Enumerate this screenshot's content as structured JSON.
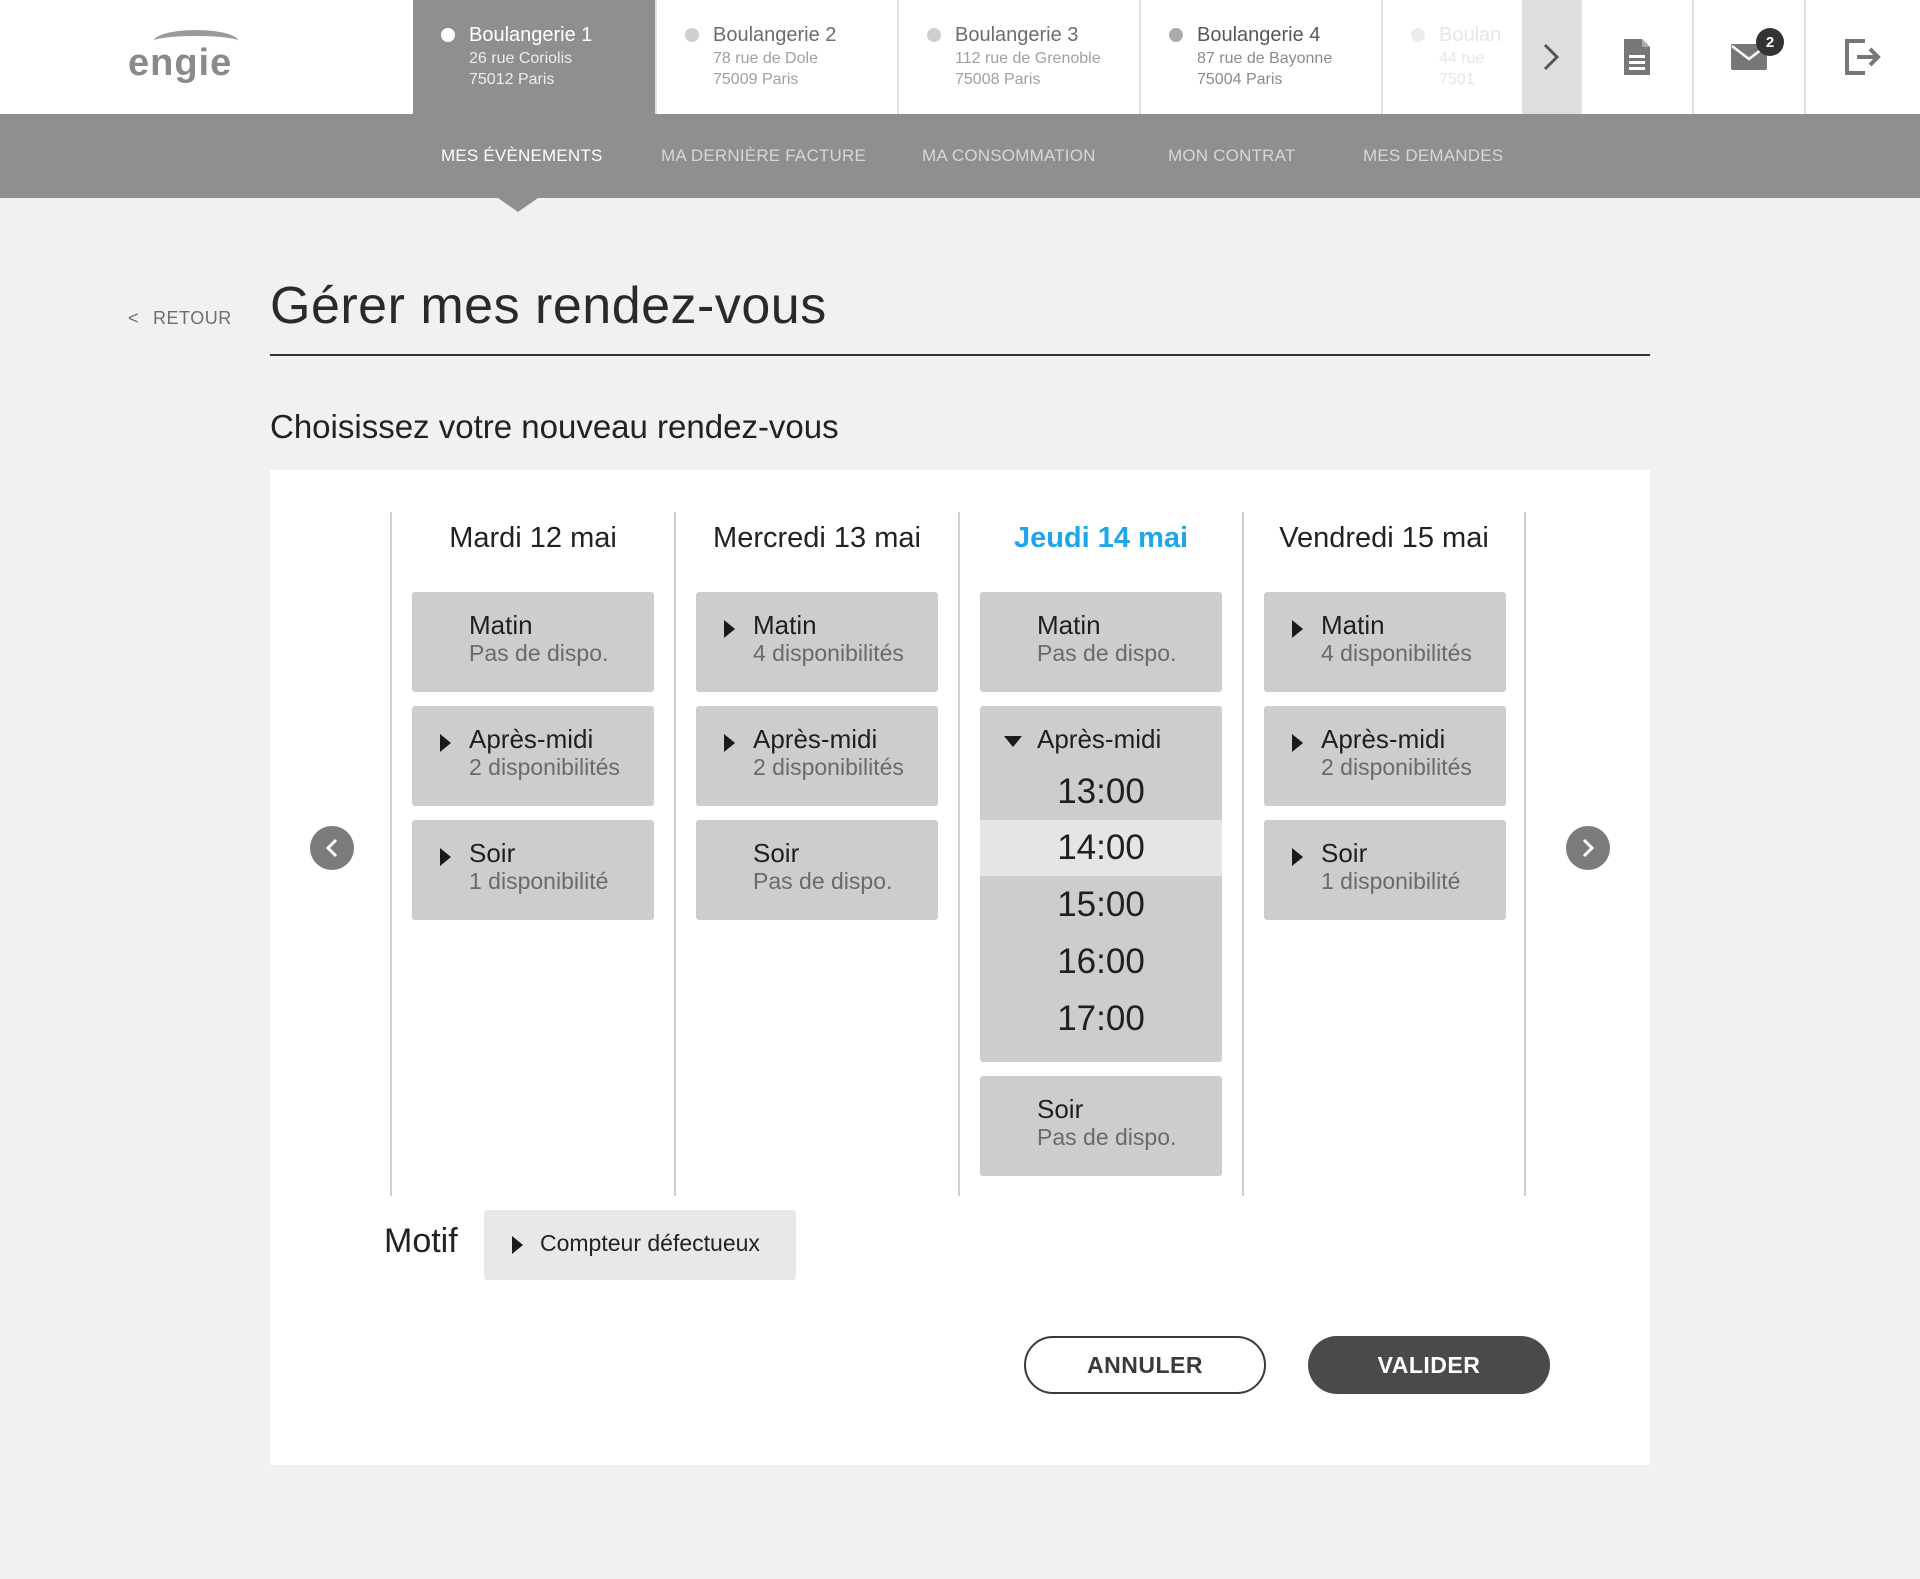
{
  "brand": {
    "logo": "engie-logo",
    "logo_text": "engie"
  },
  "sites": [
    {
      "name": "Boulangerie 1",
      "street": "26 rue Coriolis",
      "city": "75012 Paris"
    },
    {
      "name": "Boulangerie 2",
      "street": "78 rue de Dole",
      "city": "75009 Paris"
    },
    {
      "name": "Boulangerie 3",
      "street": "112 rue de Grenoble",
      "city": "75008 Paris"
    },
    {
      "name": "Boulangerie 4",
      "street": "87 rue de Bayonne",
      "city": "75004 Paris"
    },
    {
      "name": "Boulan",
      "street": "44 rue",
      "city": "7501"
    }
  ],
  "toolbar": {
    "next_icon": "chevron-right-icon",
    "document_icon": "document-icon",
    "mail_icon": "envelope-icon",
    "mail_count": "2",
    "logout_icon": "logout-icon"
  },
  "nav": [
    "MES ÉVÈNEMENTS",
    "MA DERNIÈRE FACTURE",
    "MA CONSOMMATION",
    "MON CONTRAT",
    "MES DEMANDES"
  ],
  "back_label": "RETOUR",
  "page_title": "Gérer mes rendez-vous",
  "sub_title": "Choisissez votre nouveau rendez-vous",
  "days": [
    {
      "title": "Mardi 12 mai",
      "slots": [
        {
          "name": "Matin",
          "availability": "Pas de dispo."
        },
        {
          "name": "Après-midi",
          "availability": "2 disponibilités"
        },
        {
          "name": "Soir",
          "availability": "1 disponibilité"
        }
      ]
    },
    {
      "title": "Mercredi 13 mai",
      "slots": [
        {
          "name": "Matin",
          "availability": "4 disponibilités"
        },
        {
          "name": "Après-midi",
          "availability": "2 disponibilités"
        },
        {
          "name": "Soir",
          "availability": "Pas de dispo."
        }
      ]
    },
    {
      "title": "Jeudi 14 mai",
      "slots": [
        {
          "name": "Matin",
          "availability": "Pas de dispo."
        },
        {
          "name": "Après-midi",
          "times": [
            "13:00",
            "14:00",
            "15:00",
            "16:00",
            "17:00"
          ],
          "selected": "14:00"
        },
        {
          "name": "Soir",
          "availability": "Pas de dispo."
        }
      ]
    },
    {
      "title": "Vendredi 15 mai",
      "slots": [
        {
          "name": "Matin",
          "availability": "4 disponibilités"
        },
        {
          "name": "Après-midi",
          "availability": "2 disponibilités"
        },
        {
          "name": "Soir",
          "availability": "1 disponibilité"
        }
      ]
    }
  ],
  "highlight_color": "#1ea6e8",
  "motif": {
    "label": "Motif",
    "value": "Compteur défectueux"
  },
  "buttons": {
    "cancel": "ANNULER",
    "validate": "VALIDER"
  }
}
